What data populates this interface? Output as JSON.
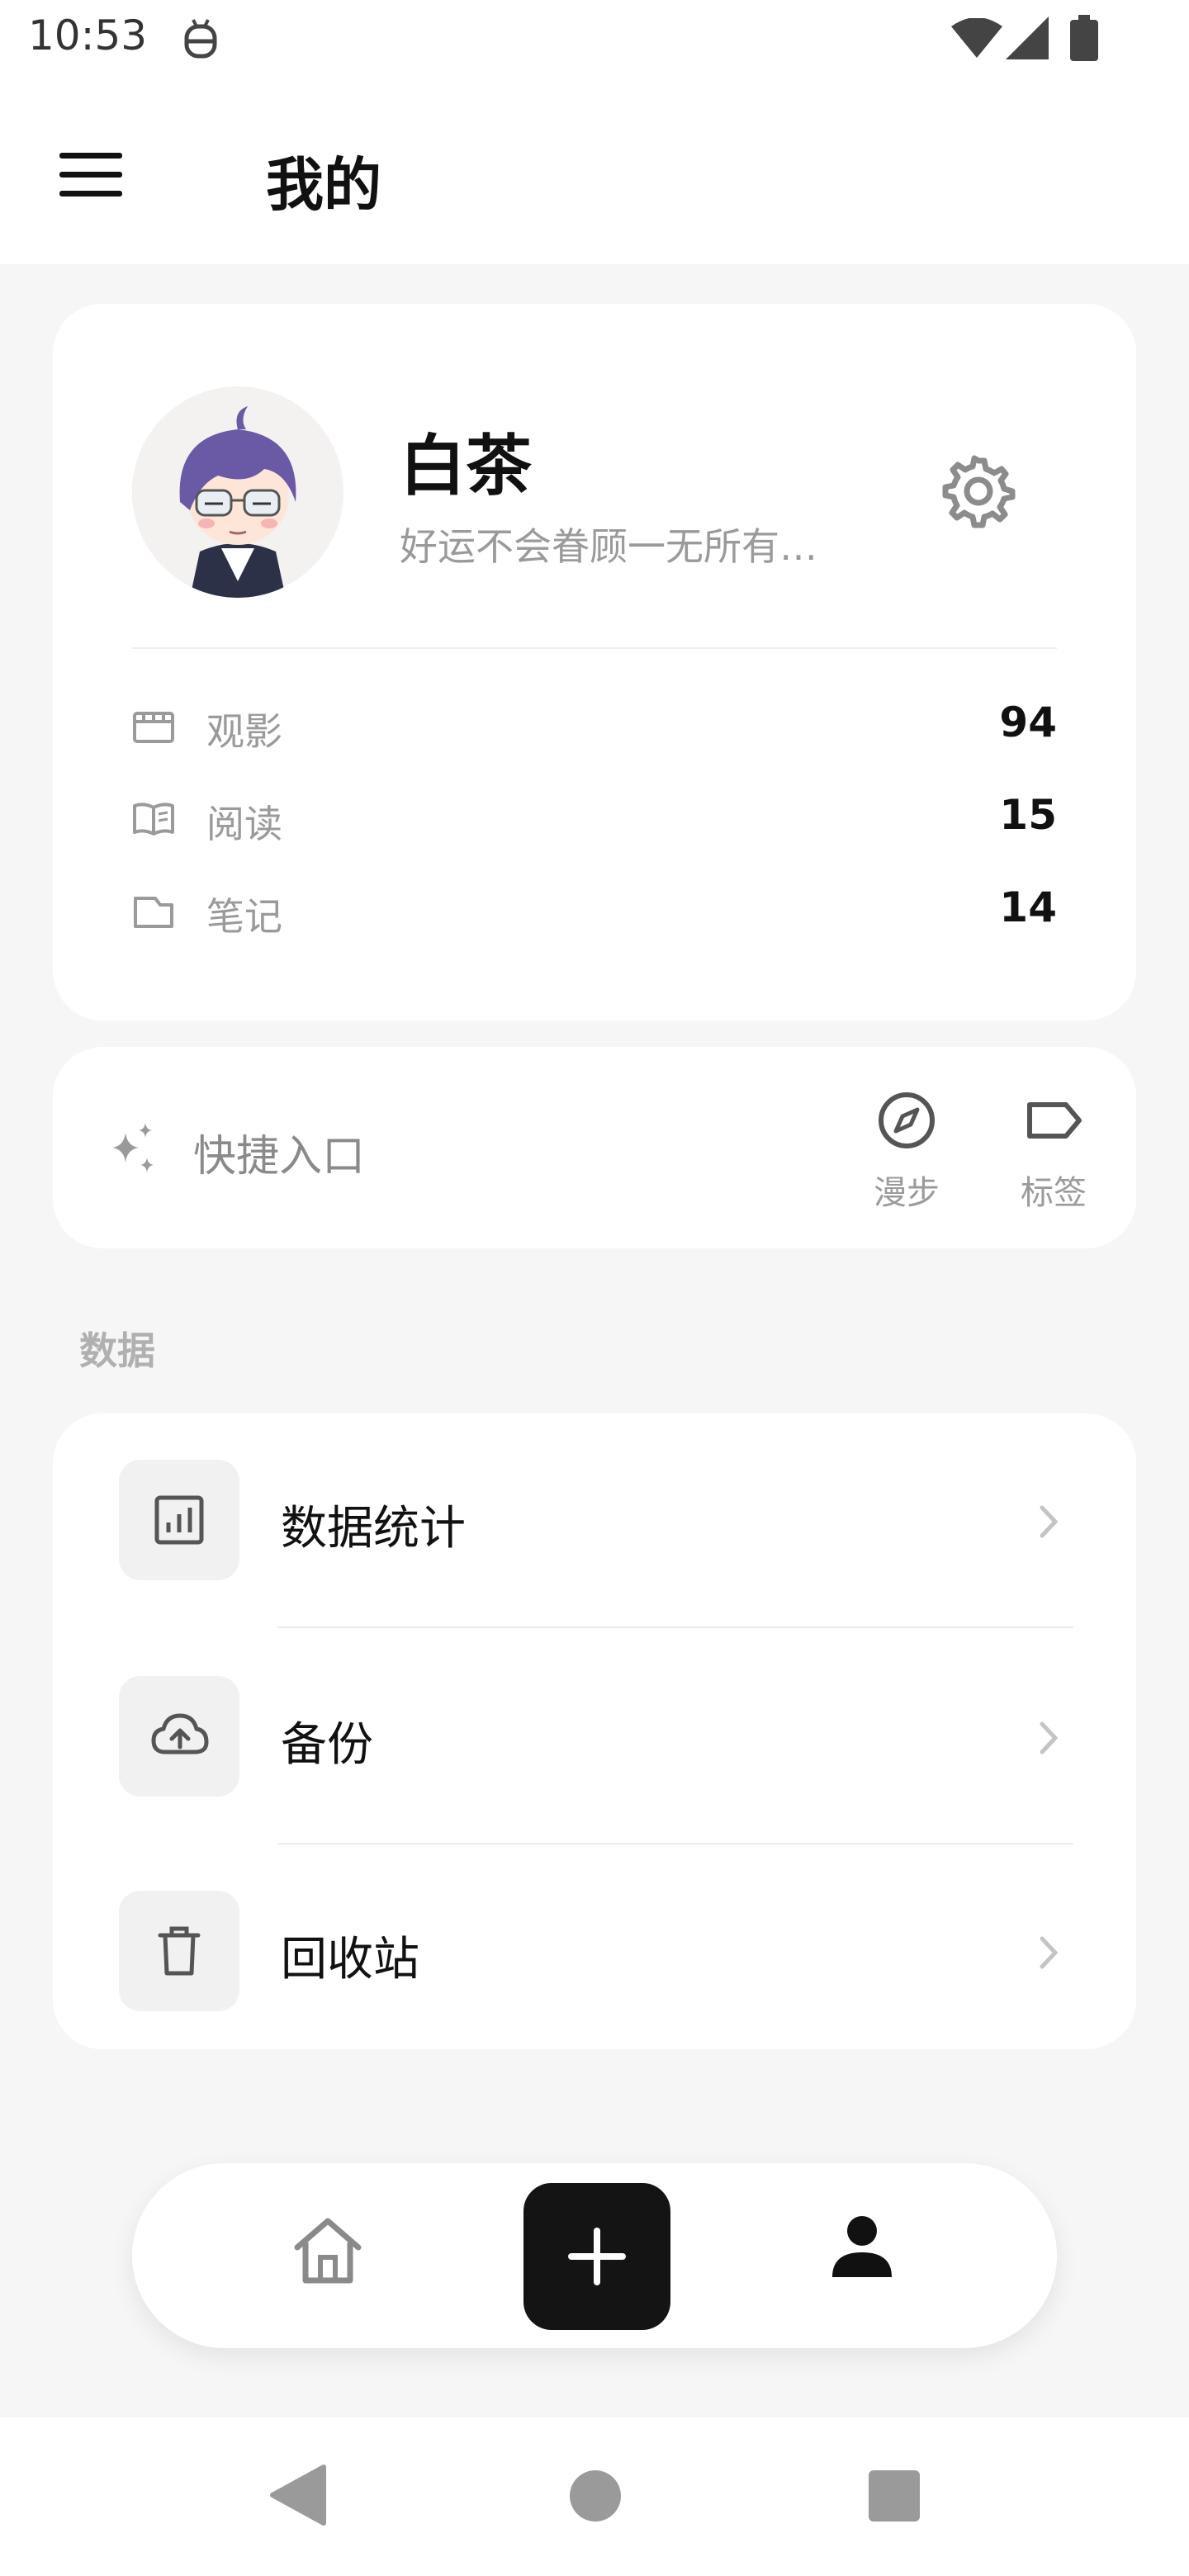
{
  "status_bar": {
    "time": "10:53"
  },
  "app_bar": {
    "title": "我的"
  },
  "profile": {
    "name": "白茶",
    "bio": "好运不会眷顾一无所有…",
    "stats": [
      {
        "label": "观影",
        "value": "94",
        "icon": "clapperboard-icon"
      },
      {
        "label": "阅读",
        "value": "15",
        "icon": "book-icon"
      },
      {
        "label": "笔记",
        "value": "14",
        "icon": "note-icon"
      }
    ]
  },
  "quick_access": {
    "label": "快捷入口",
    "items": [
      {
        "label": "漫步",
        "icon": "compass-icon"
      },
      {
        "label": "标签",
        "icon": "tag-icon"
      }
    ]
  },
  "data_section": {
    "title": "数据",
    "items": [
      {
        "label": "数据统计",
        "icon": "bar-chart-icon"
      },
      {
        "label": "备份",
        "icon": "cloud-upload-icon"
      },
      {
        "label": "回收站",
        "icon": "trash-icon"
      }
    ]
  },
  "colors": {
    "background": "#f6f6f6",
    "card": "#ffffff",
    "primary_text": "#111111",
    "secondary_text": "#9a9a9a",
    "accent_dark": "#141414"
  }
}
